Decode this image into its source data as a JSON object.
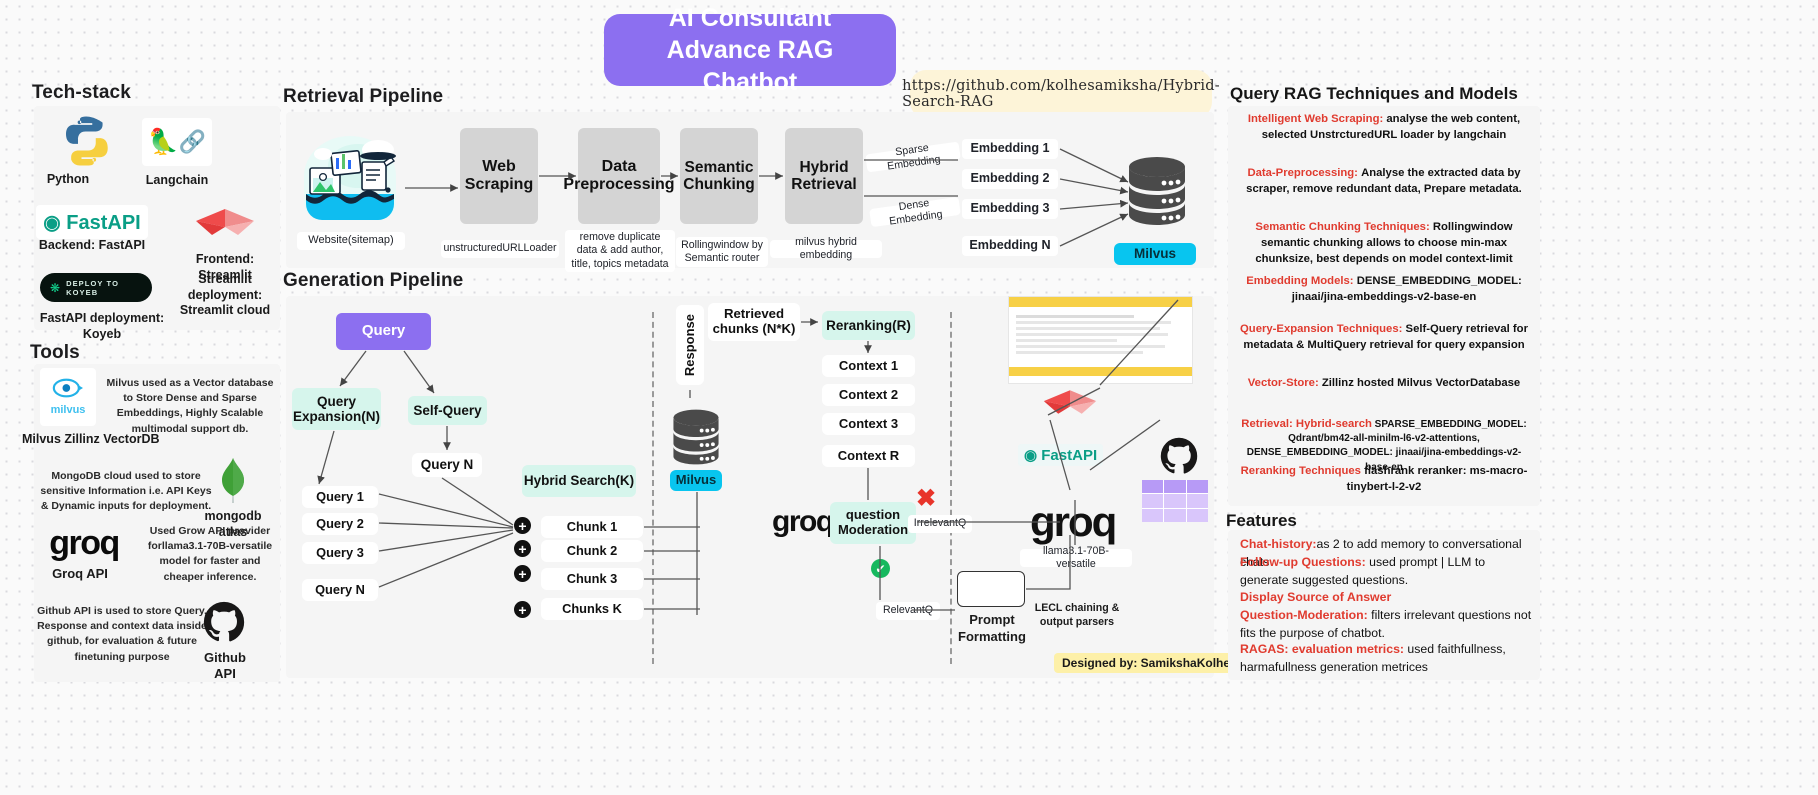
{
  "title": "AI Consultant Advance RAG Chatbot",
  "repo_url": "https://github.com/kolhesamiksha/Hybrid-Search-RAG",
  "credit": "Designed by: SamikshaKolhe:)",
  "sections": {
    "tech_stack": "Tech-stack",
    "tools": "Tools",
    "retrieval_pipeline": "Retrieval Pipeline",
    "generation_pipeline": "Generation Pipeline",
    "query_rag": "Query RAG Techniques and Models",
    "features": "Features"
  },
  "tech_stack": [
    {
      "label": "Python",
      "icon": "python-logo"
    },
    {
      "label": "Langchain",
      "icon": "langchain-parrot-link-logo"
    },
    {
      "label": "Backend: FastAPI",
      "icon": "fastapi-logo"
    },
    {
      "label": "Frontend: Streamlit",
      "icon": "streamlit-logo"
    },
    {
      "label": "Streamlit deployment: Streamlit cloud",
      "icon": "streamlit-deploy-text"
    },
    {
      "label": "FastAPI deployment: Koyeb",
      "icon": "koyeb-deploy-button"
    }
  ],
  "koyeb_button": "DEPLOY TO KOYEB",
  "tools": [
    {
      "name": "Milvus Zillinz VectorDB",
      "icon": "milvus-logo",
      "desc": "Milvus used as a Vector database to Store Dense and Sparse Embeddings, Highly Scalable multimodal support db."
    },
    {
      "name": "mongodb atlas",
      "icon": "mongodb-leaf-logo",
      "desc": "MongoDB cloud used to store sensitive Information i.e. API Keys & Dynamic inputs for deployment."
    },
    {
      "name": "Groq API",
      "icon": "groq-logo",
      "desc": "Used Grow API provider forllama3.1-70B-versatile model for faster and cheaper inference."
    },
    {
      "name": "Github API",
      "icon": "github-octocat-logo",
      "desc": "Github API is used to store Query, Response and context data inside github, for evaluation & future finetuning purpose"
    }
  ],
  "retrieval": {
    "source_caption": "Website(sitemap)",
    "stages": [
      {
        "label": "Web Scraping",
        "caption": "unstructuredURLLoader"
      },
      {
        "label": "Data Preprocessing",
        "caption": "remove duplicate data & add author, title, topics metadata"
      },
      {
        "label": "Semantic Chunking",
        "caption": "Rollingwindow by Semantic router"
      },
      {
        "label": "Hybrid Retrieval",
        "caption": "milvus hybrid embedding"
      }
    ],
    "edge_sparse": "Sparse Embedding",
    "edge_dense": "Dense Embedding",
    "embeddings": [
      "Embedding 1",
      "Embedding 2",
      "Embedding 3",
      "Embedding N"
    ],
    "db_label": "Milvus"
  },
  "generation": {
    "query": "Query",
    "query_expansion": "Query Expansion(N)",
    "self_query": "Self-Query",
    "query_n": "Query N",
    "queries": [
      "Query 1",
      "Query 2",
      "Query 3",
      "Query N"
    ],
    "hybrid_search": "Hybrid Search(K)",
    "chunks": [
      "Chunk 1",
      "Chunk 2",
      "Chunk 3",
      "Chunks K"
    ],
    "milvus": "Milvus",
    "response": "Response",
    "retrieved_chunks": "Retrieved chunks (N*K)",
    "reranking": "Reranking(R)",
    "contexts": [
      "Context 1",
      "Context 2",
      "Context 3",
      "Context R"
    ],
    "question_moderation": "question Moderation",
    "irrelevant_q": "IrrelevantQ",
    "relevant_q": "RelevantQ",
    "prompt_formatting": "Prompt Formatting",
    "lecl_caption": "LECL chaining & output parsers",
    "llm_caption": "llama3.1-70B-versatile",
    "groq_label": "groq",
    "fastapi_label": "FastAPI"
  },
  "query_rag": [
    {
      "head": "Intelligent Web Scraping:",
      "body": "analyse the web content, selected UnstrcturedURL loader by langchain"
    },
    {
      "head": "Data-Preprocessing:",
      "body": "Analyse the extracted data by scraper, remove redundant data, Prepare metadata."
    },
    {
      "head": "Semantic Chunking Techniques:",
      "body": "Rollingwindow semantic chunking allows to choose min-max chunksize, best depends on model context-limit"
    },
    {
      "head": "Embedding Models:",
      "body": "DENSE_EMBEDDING_MODEL: jinaai/jina-embeddings-v2-base-en"
    },
    {
      "head": "Query-Expansion Techniques:",
      "body": "Self-Query retrieval for metadata & MultiQuery retrieval for query expansion"
    },
    {
      "head": "Vector-Store:",
      "body": "Zillinz hosted Milvus VectorDatabase"
    },
    {
      "head": "Retrieval: Hybrid-search",
      "body": "SPARSE_EMBEDDING_MODEL: Qdrant/bm42-all-minilm-l6-v2-attentions, DENSE_EMBEDDING_MODEL: jinaai/jina-embeddings-v2-base-en"
    },
    {
      "head": "Reranking Techniques",
      "body": "flashrank reranker: ms-macro-tinybert-l-2-v2"
    }
  ],
  "features": [
    {
      "key": "Chat-history:",
      "val": "as 2 to add memory to conversational chats"
    },
    {
      "key": "Follow-up Questions:",
      "val": " used prompt | LLM to generate suggested questions."
    },
    {
      "key": "Display Source of Answer",
      "val": ""
    },
    {
      "key": "Question-Moderation:",
      "val": " filters irrelevant questions not fits the purpose of chatbot."
    },
    {
      "key": "RAGAS: evaluation metrics:",
      "val": " used faithfullness, harmafullness generation metrices"
    }
  ]
}
